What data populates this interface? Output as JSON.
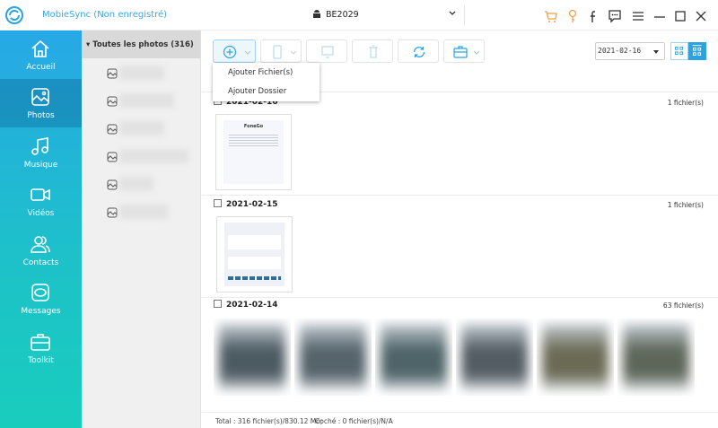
{
  "app": {
    "title": "MobieSync (Non enregistré)",
    "device": "BE2029"
  },
  "titlebar_icons": [
    "cart-icon",
    "key-icon",
    "facebook-icon",
    "feedback-icon",
    "menu-icon",
    "minimize-icon",
    "maximize-icon",
    "close-icon"
  ],
  "sidebar": {
    "items": [
      {
        "label": "Accueil",
        "icon": "home-icon"
      },
      {
        "label": "Photos",
        "icon": "photo-icon",
        "active": true
      },
      {
        "label": "Musique",
        "icon": "music-icon"
      },
      {
        "label": "Vidéos",
        "icon": "video-icon"
      },
      {
        "label": "Contacts",
        "icon": "contacts-icon"
      },
      {
        "label": "Messages",
        "icon": "messages-icon"
      },
      {
        "label": "Toolkit",
        "icon": "toolkit-icon"
      }
    ]
  },
  "albums": {
    "header": "Toutes les photos (316)"
  },
  "toolbar": {
    "add_menu": [
      "Ajouter Fichier(s)",
      "Ajouter Dossier"
    ],
    "date": "2021-02-16"
  },
  "sections": [
    {
      "date": "2021-02-16",
      "count": "1 fichier(s)",
      "thumb_title": "FoneGo"
    },
    {
      "date": "2021-02-15",
      "count": "1 fichier(s)"
    },
    {
      "date": "2021-02-14",
      "count": "63 fichier(s)"
    }
  ],
  "footer": {
    "total": "Total : 316 fichier(s)/830.12 Mo;",
    "checked": "Coché : 0 fichier(s)/N/A"
  },
  "colors": {
    "accent": "#27a8e6",
    "orange": "#f0a04b"
  }
}
